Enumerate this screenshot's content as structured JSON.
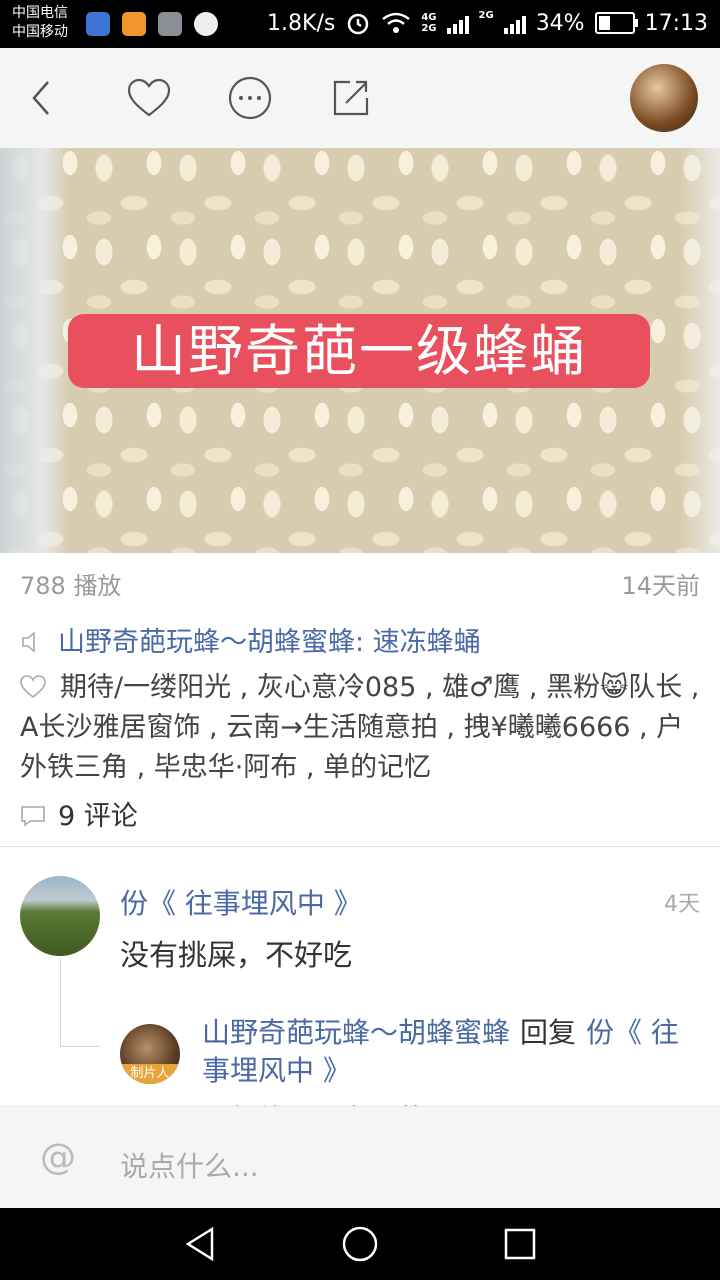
{
  "status": {
    "carrier1": "中国电信",
    "carrier2": "中国移动",
    "speed": "1.8K/s",
    "net1": "4G",
    "net2": "2G",
    "net3": "2G",
    "battery": "34%",
    "battery_level": 0.34,
    "time": "17:13"
  },
  "video": {
    "title_overlay": "山野奇葩一级蜂蛹",
    "plays": "788 播放",
    "time_ago": "14天前",
    "audio_title": "山野奇葩玩蜂～胡蜂蜜蜂: 速冻蜂蛹"
  },
  "likes": {
    "text": "期待/一缕阳光 , 灰心意冷085 , 雄♂鹰 , 黑粉😸队长 , A长沙雅居窗饰 , 云南→生活随意拍 , 拽¥曦曦6666 , 户外铁三角 , 毕忠华·阿布 , 单的记忆"
  },
  "comments_count": "9 评论",
  "comment": {
    "name": "份《 往事埋风中 》",
    "time": "4天",
    "text": "没有挑屎，不好吃"
  },
  "reply": {
    "name": "山野奇葩玩蜂～胡蜂蜜蜂",
    "reply_word": "回复",
    "target": "份《 往事埋风中 》",
    "badge": "制片人",
    "text_cut": "一级蜂是没有屎的"
  },
  "input": {
    "at_symbol": "@",
    "placeholder": "说点什么..."
  },
  "colors": {
    "accent": "#e8505e",
    "link": "#4a6aa5"
  }
}
